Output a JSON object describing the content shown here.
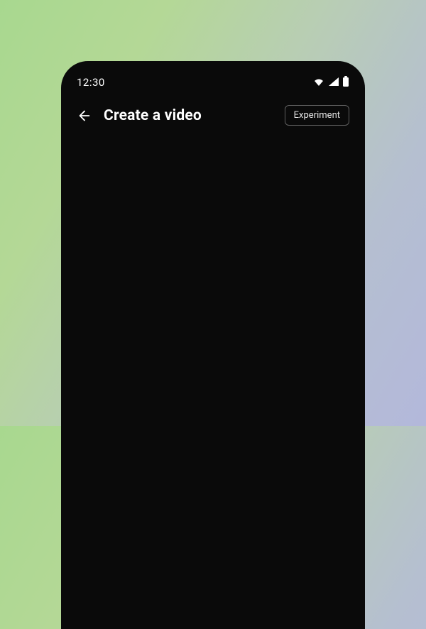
{
  "status_bar": {
    "time": "12:30"
  },
  "header": {
    "title": "Create a video",
    "experiment_label": "Experiment"
  }
}
